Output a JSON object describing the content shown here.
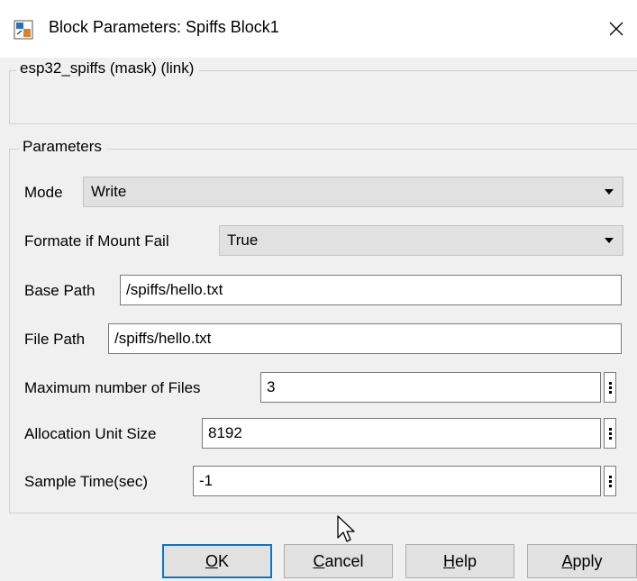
{
  "window": {
    "title": "Block Parameters: Spiffs Block1",
    "icon": "simulink-block-icon",
    "close_icon": "close-x-icon"
  },
  "description_group": {
    "legend": "esp32_spiffs (mask) (link)"
  },
  "parameters": {
    "legend": "Parameters",
    "mode": {
      "label": "Mode",
      "value": "Write"
    },
    "format_if_mount_fail": {
      "label": "Formate if Mount Fail",
      "value": "True"
    },
    "base_path": {
      "label": "Base Path",
      "value": "/spiffs/hello.txt"
    },
    "file_path": {
      "label": "File Path",
      "value": "/spiffs/hello.txt"
    },
    "max_files": {
      "label": "Maximum number of Files",
      "value": "3"
    },
    "allocation_unit_size": {
      "label": "Allocation Unit Size",
      "value": "8192"
    },
    "sample_time": {
      "label": "Sample Time(sec)",
      "value": "-1"
    }
  },
  "buttons": {
    "ok": {
      "first": "O",
      "rest": "K"
    },
    "cancel": {
      "first": "C",
      "rest": "ancel"
    },
    "help": {
      "first": "H",
      "rest": "elp"
    },
    "apply": {
      "first": "A",
      "rest": "pply"
    }
  },
  "colors": {
    "window_bg": "#f0f0f0",
    "titlebar_bg": "#ffffff",
    "default_button_border": "#0078d7"
  }
}
